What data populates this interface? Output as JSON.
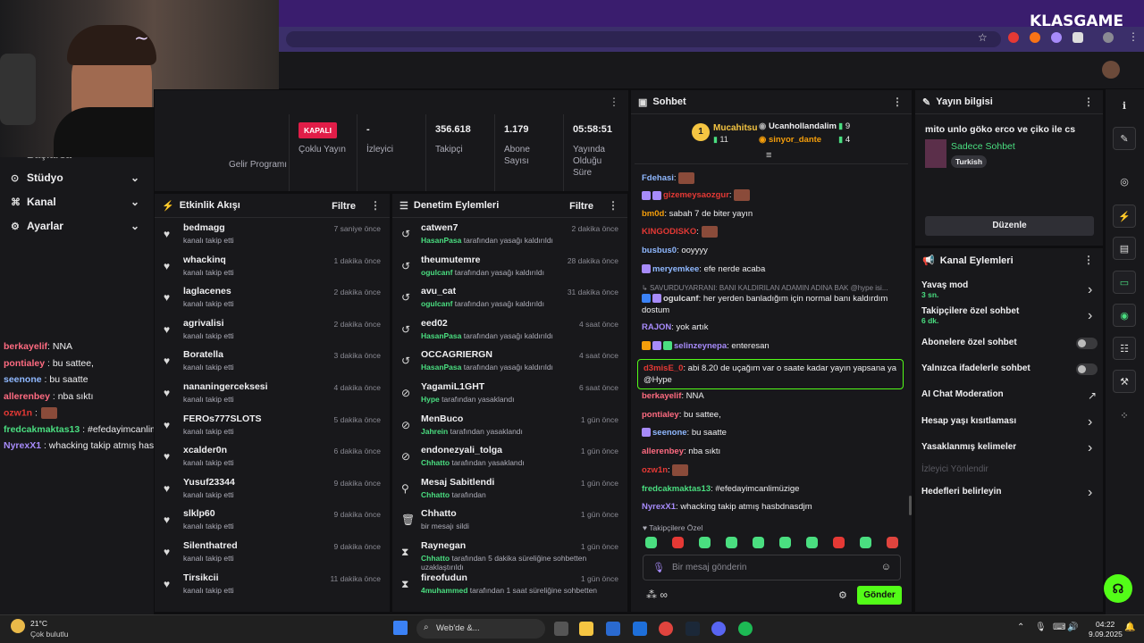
{
  "browser": {
    "brand": "KLASGAME"
  },
  "left_menu": [
    {
      "label": "Stüdyo"
    },
    {
      "label": "Kanal"
    },
    {
      "label": "Ayarlar"
    }
  ],
  "left_menu_cut_label": "Başlarsa",
  "left_chat": [
    {
      "user": "berkayelif",
      "text": ": NNA",
      "color": "#ff6b81"
    },
    {
      "user": "pontialey",
      "text": " : bu sattee,",
      "color": "#ff6b81"
    },
    {
      "user": "seenone",
      "text": " : bu saatte",
      "color": "#8fb8ff"
    },
    {
      "user": "allerenbey",
      "text": " : nba sıktı",
      "color": "#ff6b81"
    },
    {
      "user": "ozw1n",
      "text": " :",
      "color": "#e53935"
    },
    {
      "user": "fredcakmaktas13",
      "text": " : #efedayimcanlimüzige",
      "color": "#4ade80"
    },
    {
      "user": "NyrexX1",
      "text": " : whacking takip atmış hasbdnasdjm",
      "color": "#a78bfa"
    }
  ],
  "stats": {
    "status_badge": "KAPALI",
    "gelir_label": "Gelir Programı",
    "coklu": "Çoklu Yayın",
    "items": [
      {
        "value": "-",
        "label": "İzleyici"
      },
      {
        "value": "356.618",
        "label": "Takipçi"
      },
      {
        "value": "1.179",
        "label": "Abone Sayısı"
      },
      {
        "value": "05:58:51",
        "label": "Yayında Olduğu Süre"
      }
    ]
  },
  "activity": {
    "title": "Etkinlik Akışı",
    "filter": "Filtre",
    "rows": [
      {
        "name": "bedmagg",
        "sub": "kanalı takip etti",
        "time": "7 saniye önce"
      },
      {
        "name": "whackinq",
        "sub": "kanalı takip etti",
        "time": "1 dakika önce"
      },
      {
        "name": "laglacenes",
        "sub": "kanalı takip etti",
        "time": "2 dakika önce"
      },
      {
        "name": "agrivalisi",
        "sub": "kanalı takip etti",
        "time": "2 dakika önce"
      },
      {
        "name": "Boratella",
        "sub": "kanalı takip etti",
        "time": "3 dakika önce"
      },
      {
        "name": "nananingerceksesi",
        "sub": "kanalı takip etti",
        "time": "4 dakika önce"
      },
      {
        "name": "FEROs777SLOTS",
        "sub": "kanalı takip etti",
        "time": "5 dakika önce"
      },
      {
        "name": "xcalder0n",
        "sub": "kanalı takip etti",
        "time": "6 dakika önce"
      },
      {
        "name": "Yusuf23344",
        "sub": "kanalı takip etti",
        "time": "9 dakika önce"
      },
      {
        "name": "slklp60",
        "sub": "kanalı takip etti",
        "time": "9 dakika önce"
      },
      {
        "name": "Silenthatred",
        "sub": "kanalı takip etti",
        "time": "9 dakika önce"
      },
      {
        "name": "Tirsikcii",
        "sub": "kanalı takip etti",
        "time": "11 dakika önce"
      }
    ]
  },
  "moderation": {
    "title": "Denetim Eylemleri",
    "filter": "Filtre",
    "rows": [
      {
        "icon": "↺",
        "name": "catwen7",
        "mod": "HasanPasa",
        "sub": " tarafından yasağı kaldırıldı",
        "time": "2 dakika önce"
      },
      {
        "icon": "↺",
        "name": "theumutemre",
        "mod": "ogulcanf",
        "sub": " tarafından yasağı kaldırıldı",
        "time": "28 dakika önce"
      },
      {
        "icon": "↺",
        "name": "avu_cat",
        "mod": "ogulcanf",
        "sub": " tarafından yasağı kaldırıldı",
        "time": "31 dakika önce"
      },
      {
        "icon": "↺",
        "name": "eed02",
        "mod": "HasanPasa",
        "sub": " tarafından yasağı kaldırıldı",
        "time": "4 saat önce"
      },
      {
        "icon": "↺",
        "name": "OCCAGRIERGN",
        "mod": "HasanPasa",
        "sub": " tarafından yasağı kaldırıldı",
        "time": "4 saat önce"
      },
      {
        "icon": "⊘",
        "name": "YagamiL1GHT",
        "mod": "Hype",
        "sub": " tarafından yasaklandı",
        "time": "6 saat önce"
      },
      {
        "icon": "⊘",
        "name": "MenBuco",
        "mod": "Jahrein",
        "sub": " tarafından yasaklandı",
        "time": "1 gün önce"
      },
      {
        "icon": "⊘",
        "name": "endonezyali_tolga",
        "mod": "Chhatto",
        "sub": " tarafından yasaklandı",
        "time": "1 gün önce"
      },
      {
        "icon": "⚲",
        "name": "Mesaj Sabitlendi",
        "mod": "Chhatto",
        "sub": " tarafından",
        "time": "1 gün önce"
      },
      {
        "icon": "🗑",
        "name": "Chhatto",
        "mod": "",
        "sub": "bir mesajı sildi",
        "time": "1 gün önce"
      },
      {
        "icon": "⧗",
        "name": "Raynegan",
        "mod": "Chhatto",
        "sub": " tarafından 5 dakika süreliğine sohbetten",
        "sub2": "uzaklaştırıldı",
        "time": "1 gün önce"
      },
      {
        "icon": "⧗",
        "name": "fireofudun",
        "mod": "4muhammed",
        "sub": " tarafından 1 saat süreliğine sohbetten",
        "time": "1 gün önce"
      }
    ]
  },
  "chat": {
    "title": "Sohbet",
    "top_user": {
      "rank": "1",
      "name": "Mucahitsu",
      "count": "11"
    },
    "leaders": [
      {
        "name": "Ucanhollandalim",
        "count": "9",
        "color": "#dcdcdc"
      },
      {
        "name": "sinyor_dante",
        "count": "4",
        "color": "#f59e0b"
      }
    ],
    "messages": [
      {
        "user": "Fdehasi",
        "color": "#8fb8ff",
        "text": "",
        "emote": true
      },
      {
        "user": "gizemeysaozgur",
        "color": "#e53935",
        "text": "",
        "emote": true,
        "badges": [
          "#a78bfa",
          "#a78bfa"
        ]
      },
      {
        "user": "bm0d",
        "color": "#f59e0b",
        "text": "sabah 7 de biter yayın"
      },
      {
        "user": "KINGODISKO",
        "color": "#e53935",
        "text": "",
        "emote": true
      },
      {
        "user": "busbus0",
        "color": "#8fb8ff",
        "text": "ooyyyy"
      },
      {
        "user": "meryemkee",
        "color": "#8fb8ff",
        "text": "efe nerde acaba",
        "badges": [
          "#a78bfa"
        ]
      },
      {
        "user": "ogulcanf",
        "color": "#dcdcdc",
        "text": "her yerden banladığım için normal banı kaldırdım",
        "text2": "dostum",
        "badges": [
          "#3b82f6",
          "#a78bfa"
        ],
        "reply": "SAVURDUYARRANI: BANI KALDIRILAN ADAMIN ADINA BAK @hype isi..."
      },
      {
        "user": "RAJON",
        "color": "#a78bfa",
        "text": "yok artık"
      },
      {
        "user": "selinzeynepa",
        "color": "#a78bfa",
        "text": "enteresan",
        "badges": [
          "#f59e0b",
          "#a78bfa",
          "#4ade80"
        ]
      },
      {
        "user": "d3misE_0",
        "color": "#e53935",
        "text": "abi 8.20 de uçağım var o saate kadar yayın yapsana ya",
        "text2": "@Hype",
        "highlight": true
      },
      {
        "user": "berkayelif",
        "color": "#ff6b81",
        "text": "NNA"
      },
      {
        "user": "pontialey",
        "color": "#ff6b81",
        "text": "bu sattee,"
      },
      {
        "user": "seenone",
        "color": "#8fb8ff",
        "text": "bu saatte",
        "badges": [
          "#a78bfa"
        ]
      },
      {
        "user": "allerenbey",
        "color": "#ff6b81",
        "text": "nba sıktı"
      },
      {
        "user": "ozw1n",
        "color": "#e53935",
        "text": "",
        "emote": true
      },
      {
        "user": "fredcakmaktas13",
        "color": "#4ade80",
        "text": "#efedayimcanlimüzige"
      },
      {
        "user": "NyrexX1",
        "color": "#a78bfa",
        "text": "whacking takip atmış hasbdnasdjm"
      }
    ],
    "follower_label": "Takipçilere Özel",
    "input_placeholder": "Bir mesaj gönderin",
    "send": "Gönder"
  },
  "stream_info": {
    "title": "Yayın bilgisi",
    "stream_title": "mito unlo göko erco ve çiko ile cs",
    "category": "Sadece Sohbet",
    "tag": "Turkish",
    "edit": "Düzenle"
  },
  "channel_actions": {
    "title": "Kanal Eylemleri",
    "items": [
      {
        "label": "Yavaş mod",
        "sub": "3 sn.",
        "type": "arrow"
      },
      {
        "label": "Takipçilere özel sohbet",
        "sub": "6 dk.",
        "type": "arrow"
      },
      {
        "label": "Abonelere özel sohbet",
        "type": "toggle"
      },
      {
        "label": "Yalnızca ifadelerle sohbet",
        "type": "toggle"
      },
      {
        "label": "AI Chat Moderation",
        "type": "ext"
      },
      {
        "label": "Hesap yaşı kısıtlaması",
        "type": "arrow"
      },
      {
        "label": "Yasaklanmış kelimeler",
        "type": "arrow"
      },
      {
        "label": "İzleyici Yönlendir",
        "type": "disabled"
      },
      {
        "label": "Hedefleri belirleyin",
        "type": "arrow"
      }
    ]
  },
  "taskbar": {
    "weather_temp": "21°C",
    "weather_desc": "Çok bulutlu",
    "search": "Web'de &...",
    "time": "04:22",
    "date": "9.09.2025"
  }
}
